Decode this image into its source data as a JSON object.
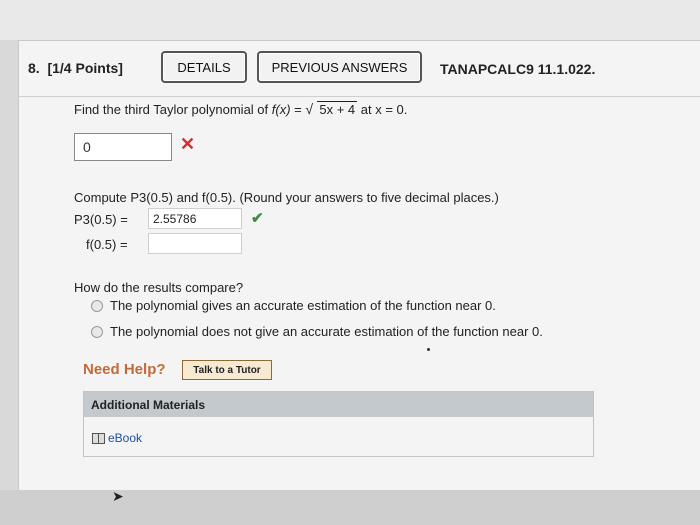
{
  "question": {
    "number": "8.",
    "points": "[1/4 Points]",
    "details_label": "DETAILS",
    "previous_answers_label": "PREVIOUS ANSWERS",
    "source_id": "TANAPCALC9 11.1.022."
  },
  "prompt": {
    "lead": "Find the third Taylor polynomial of ",
    "func": "f(x)",
    "equals": " = ",
    "sqrt_arg": "5x + 4",
    "tail": " at x = 0."
  },
  "answer1": {
    "value": "0",
    "status_icon": "x-mark-icon"
  },
  "compute": {
    "text": "Compute P3(0.5) and f(0.5). (Round your answers to five decimal places.)",
    "p3_label": "P3(0.5)  =",
    "p3_value": "2.55786",
    "p3_status_icon": "check-icon",
    "f_label": "f(0.5)  =",
    "f_value": ""
  },
  "compare": {
    "question": "How do the results compare?",
    "options": [
      "The polynomial gives an accurate estimation of the function near 0.",
      "The polynomial does not give an accurate estimation of the function near 0."
    ]
  },
  "help": {
    "need_help": "Need Help?",
    "tutor_button": "Talk to a Tutor"
  },
  "materials": {
    "heading": "Additional Materials",
    "ebook": "eBook"
  },
  "colors": {
    "error": "#d62c2c",
    "success": "#3b8e3b",
    "need_help": "#c26b3a",
    "link": "#1c4f9c"
  }
}
